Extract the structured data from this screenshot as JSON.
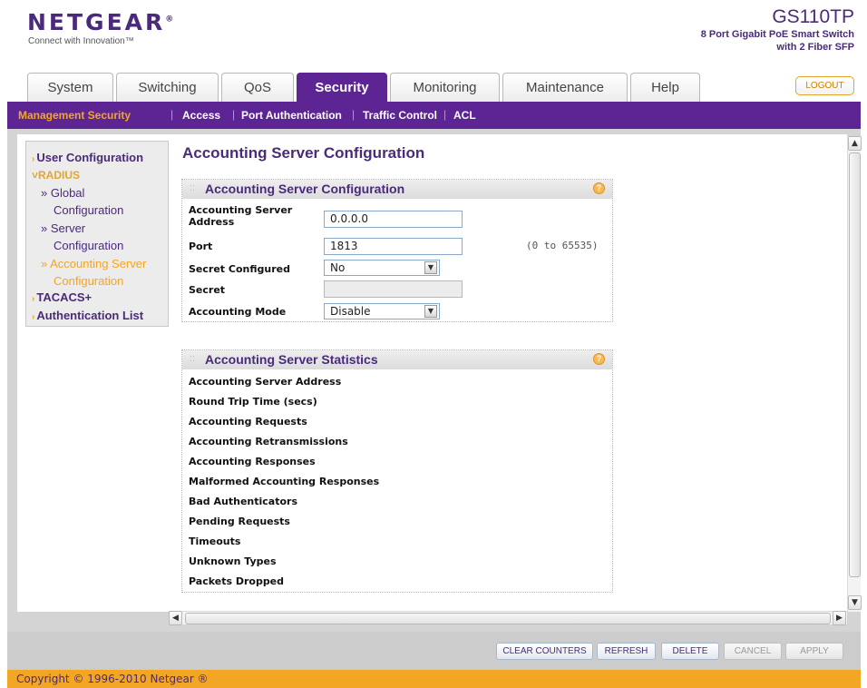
{
  "header": {
    "logo": "NETGEAR",
    "logo_mark": "®",
    "tagline": "Connect with Innovation™",
    "model": "GS110TP",
    "model_desc_line1": "8 Port Gigabit PoE Smart Switch",
    "model_desc_line2": "with 2 Fiber SFP",
    "logout_label": "LOGOUT"
  },
  "tabs": [
    {
      "label": "System"
    },
    {
      "label": "Switching"
    },
    {
      "label": "QoS"
    },
    {
      "label": "Security"
    },
    {
      "label": "Monitoring"
    },
    {
      "label": "Maintenance"
    },
    {
      "label": "Help"
    }
  ],
  "active_tab": "Security",
  "subnav": [
    {
      "label": "Management Security"
    },
    {
      "label": "Access"
    },
    {
      "label": "Port Authentication"
    },
    {
      "label": "Traffic Control"
    },
    {
      "label": "ACL"
    }
  ],
  "leftnav": {
    "user_config": "User Configuration",
    "radius": "RADIUS",
    "global_line1": "» Global",
    "global_line2": "Configuration",
    "server_line1": "» Server",
    "server_line2": "Configuration",
    "acct_line1": "» Accounting Server",
    "acct_line2": "Configuration",
    "tacacs": "TACACS+",
    "auth_list": "Authentication List"
  },
  "page_title": "Accounting Server Configuration",
  "config_box": {
    "title": "Accounting Server Configuration",
    "help": "?",
    "address_label_line1": "Accounting Server",
    "address_label_line2": "Address",
    "address_value": "0.0.0.0",
    "port_label": "Port",
    "port_value": "1813",
    "port_range": "(0 to 65535)",
    "secret_configured_label": "Secret Configured",
    "secret_configured_value": "No",
    "secret_label": "Secret",
    "secret_value": "",
    "accounting_mode_label": "Accounting Mode",
    "accounting_mode_value": "Disable"
  },
  "stats_box": {
    "title": "Accounting Server Statistics",
    "help": "?",
    "labels": [
      "Accounting Server Address",
      "Round Trip Time (secs)",
      "Accounting Requests",
      "Accounting Retransmissions",
      "Accounting Responses",
      "Malformed Accounting Responses",
      "Bad Authenticators",
      "Pending Requests",
      "Timeouts",
      "Unknown Types",
      "Packets Dropped"
    ]
  },
  "buttons": {
    "clear_counters": "CLEAR COUNTERS",
    "refresh": "REFRESH",
    "delete": "DELETE",
    "cancel": "CANCEL",
    "apply": "APPLY"
  },
  "footer": "Copyright © 1996-2010 Netgear ®",
  "colors": {
    "brand_purple": "#5c2593",
    "accent_orange": "#f3a623"
  }
}
